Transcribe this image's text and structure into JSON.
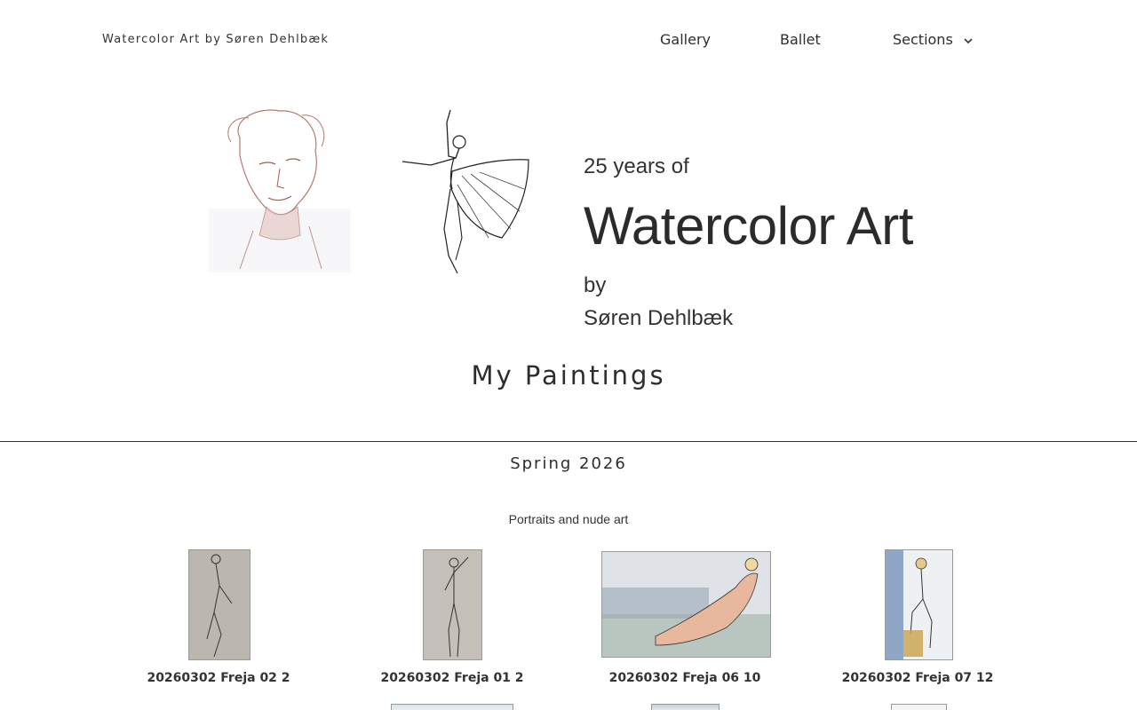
{
  "header": {
    "site_title": "Watercolor Art by Søren Dehlbæk",
    "nav": [
      {
        "label": "Gallery"
      },
      {
        "label": "Ballet"
      },
      {
        "label": "Sections"
      }
    ]
  },
  "hero": {
    "line1": "25 years of",
    "line2": "Watercolor Art",
    "line3": "by",
    "line4": "Søren Dehlbæk"
  },
  "main": {
    "section_title": "My Paintings",
    "season": "Spring 2026",
    "subheading": "Portraits and nude art",
    "paintings": [
      {
        "caption": "20260302 Freja 02 2"
      },
      {
        "caption": "20260302 Freja 01 2"
      },
      {
        "caption": "20260302 Freja 06 10"
      },
      {
        "caption": "20260302 Freja 07 12"
      }
    ]
  },
  "icons": {
    "nav_dropdown": "chevron-down-icon"
  }
}
